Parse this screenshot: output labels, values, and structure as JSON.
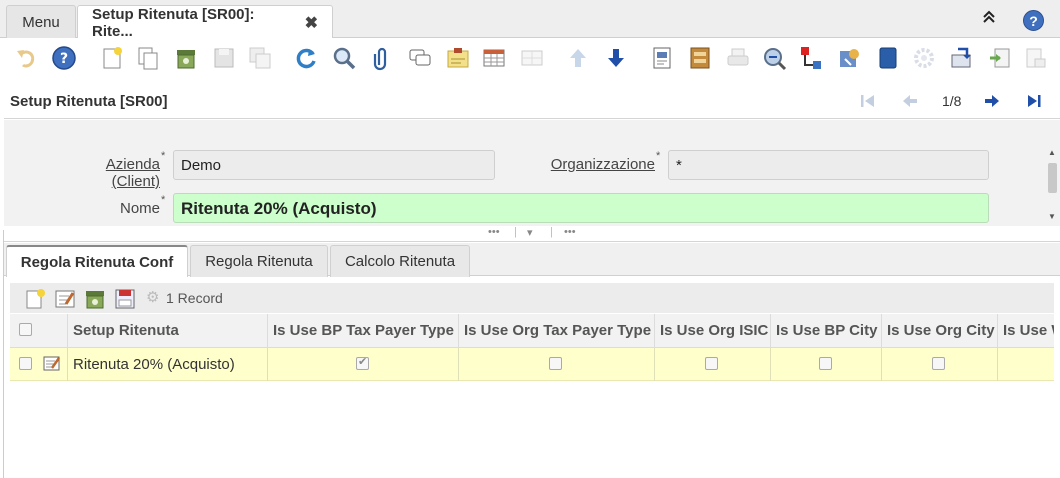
{
  "window_tabs": {
    "menu_label": "Menu",
    "active_label": "Setup Ritenuta [SR00]: Rite...",
    "close_glyph": "✖",
    "collapse_glyph": "⌃⌃",
    "help_glyph": "?"
  },
  "toolbar": {
    "icons": [
      "undo-icon",
      "help-icon",
      "new-record-icon",
      "copy-record-icon",
      "delete-record-icon",
      "save-icon",
      "save-new-icon",
      "refresh-icon",
      "find-icon",
      "attachment-icon",
      "chat-icon",
      "note-icon",
      "grid-toggle-icon",
      "multi-record-icon",
      "previous-record-icon",
      "next-record-icon",
      "report-icon",
      "archive-icon",
      "print-icon",
      "zoom-across-icon",
      "active-workflows-icon",
      "requests-icon",
      "product-info-icon",
      "process-icon",
      "export-icon",
      "import-icon",
      "post-icon"
    ]
  },
  "header": {
    "title": "Setup Ritenuta [SR00]",
    "record_position": "1/8"
  },
  "form": {
    "client_label": "Azienda (Client)",
    "client_value": "Demo",
    "org_label": "Organizzazione",
    "org_value": "*",
    "name_label": "Nome",
    "name_value": "Ritenuta 20% (Acquisto)",
    "required_mark": "*"
  },
  "detail_tabs": [
    {
      "label": "Regola Ritenuta Conf",
      "active": true
    },
    {
      "label": "Regola Ritenuta",
      "active": false
    },
    {
      "label": "Calcolo Ritenuta",
      "active": false
    }
  ],
  "detail_toolbar": {
    "record_count": "1 Record"
  },
  "grid": {
    "columns": [
      "Setup Ritenuta",
      "Is Use BP Tax Payer Type",
      "Is Use Org Tax Payer Type",
      "Is Use Org ISIC",
      "Is Use BP City",
      "Is Use Org City",
      "Is Use W"
    ],
    "rows": [
      {
        "setup": "Ritenuta 20% (Acquisto)",
        "bp_tax_payer": true,
        "org_tax_payer": false,
        "org_isic": false,
        "bp_city": false,
        "org_city": false
      }
    ]
  },
  "colors": {
    "name_field_bg": "#ccffcc",
    "selected_row_bg": "#ffffcc",
    "accent_blue": "#1f4fa8"
  }
}
